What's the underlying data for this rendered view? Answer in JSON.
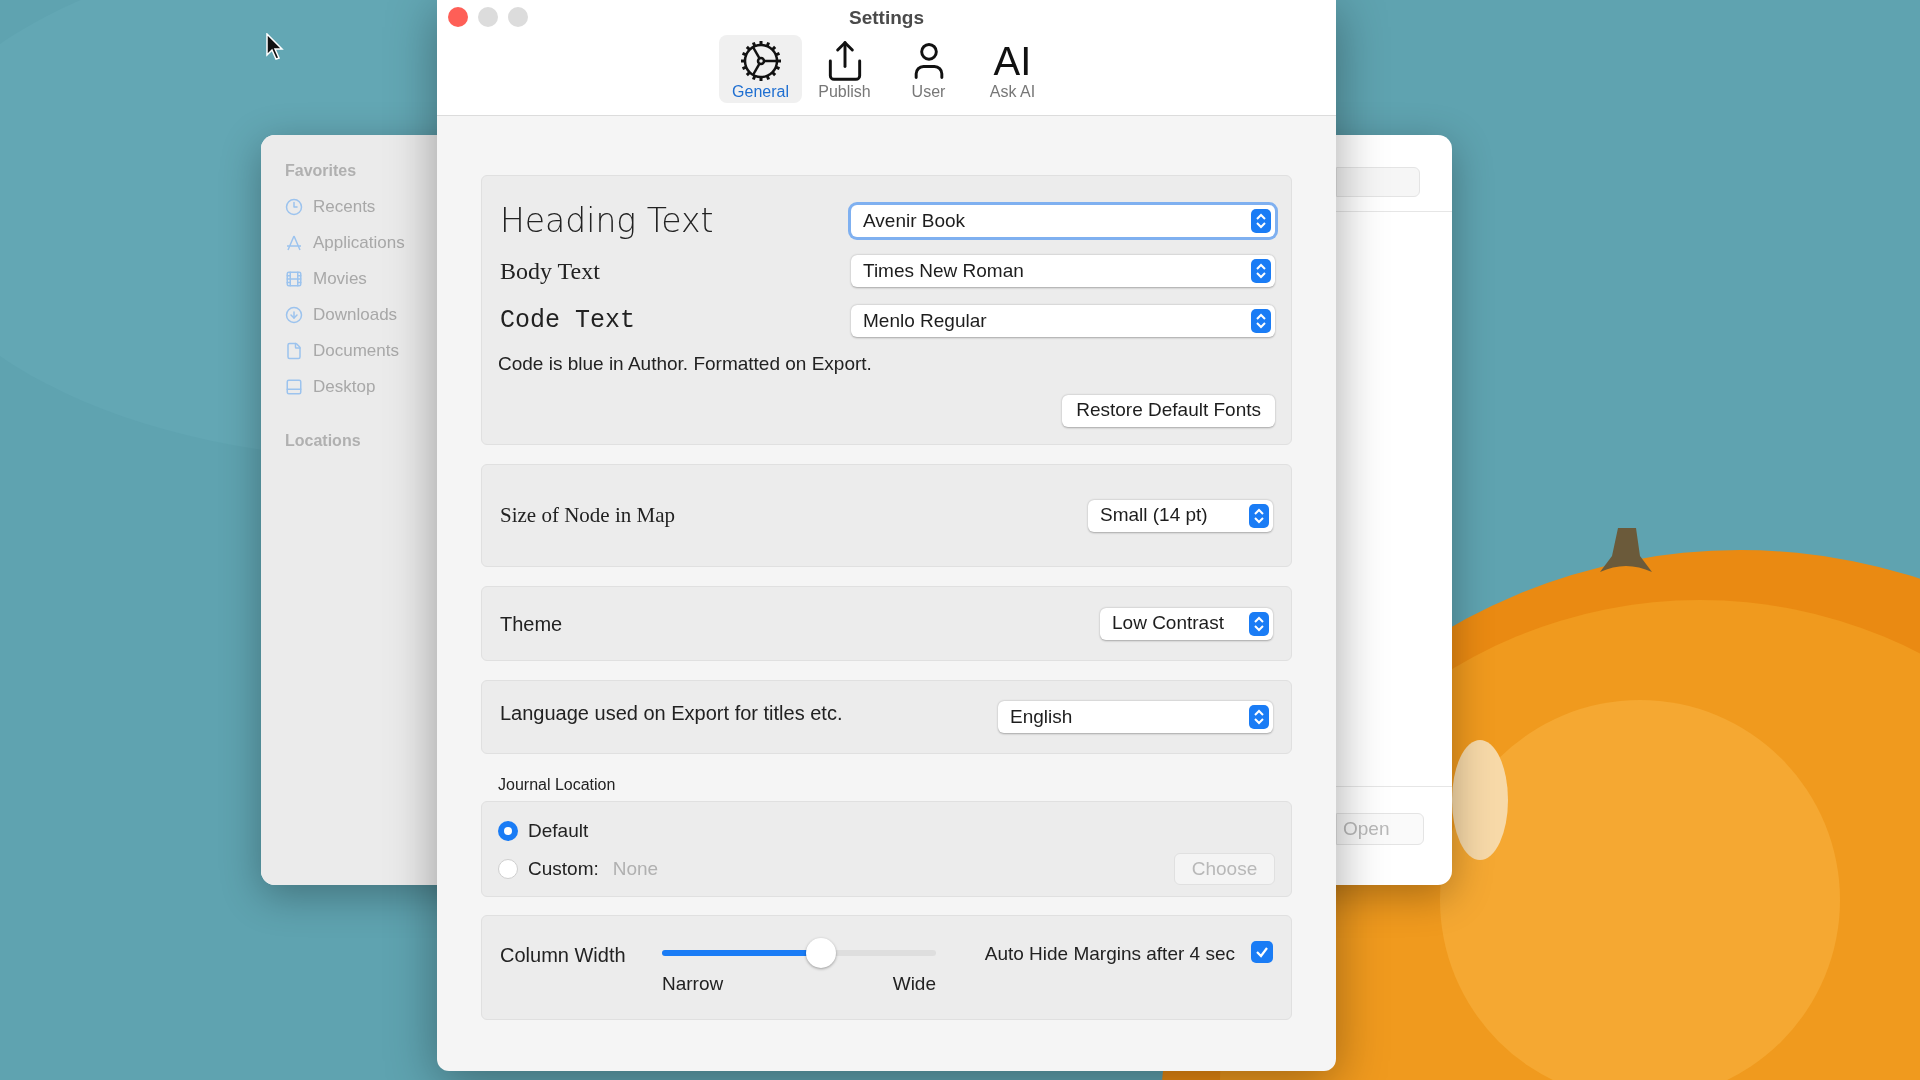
{
  "back_window": {
    "sidebar": [
      {
        "title": "Favorites",
        "items": [
          {
            "label": "Recents"
          },
          {
            "label": "Applications"
          },
          {
            "label": "Movies"
          },
          {
            "label": "Downloads"
          },
          {
            "label": "Documents"
          },
          {
            "label": "Desktop"
          }
        ]
      },
      {
        "title": "Locations"
      }
    ],
    "open_button": {
      "label": "Open",
      "disabled": true
    }
  },
  "window": {
    "title": "Settings"
  },
  "tabs": [
    {
      "label": "General",
      "selected": true
    },
    {
      "label": "Publish",
      "selected": false
    },
    {
      "label": "User",
      "selected": false
    },
    {
      "label": "Ask AI",
      "icon_text": "AI",
      "selected": false
    }
  ],
  "fonts": {
    "rows": [
      {
        "label": "Heading Text",
        "kind": "heading",
        "value": "Avenir Book",
        "focused": true
      },
      {
        "label": "Body Text",
        "kind": "body",
        "value": "Times New Roman",
        "focused": false
      },
      {
        "label": "Code Text",
        "kind": "code",
        "value": "Menlo Regular",
        "focused": false
      }
    ],
    "note": "Code is blue in Author. Formatted on Export.",
    "restore_button": "Restore Default Fonts"
  },
  "node_size": {
    "label": "Size of Node in Map",
    "value": "Small (14 pt)"
  },
  "theme": {
    "label": "Theme",
    "value": "Low Contrast"
  },
  "language": {
    "label": "Language used on Export for titles etc.",
    "value": "English"
  },
  "journal": {
    "title": "Journal Location",
    "options": [
      {
        "label": "Default",
        "selected": true
      },
      {
        "label": "Custom:",
        "selected": false
      }
    ],
    "custom_placeholder": "None",
    "choose_button": {
      "label": "Choose",
      "disabled": true
    }
  },
  "column_width": {
    "label": "Column Width",
    "level": 0.59,
    "min_label": "Narrow",
    "max_label": "Wide"
  },
  "auto_hide": {
    "label": "Auto Hide Margins after 4 sec",
    "checked": true
  }
}
